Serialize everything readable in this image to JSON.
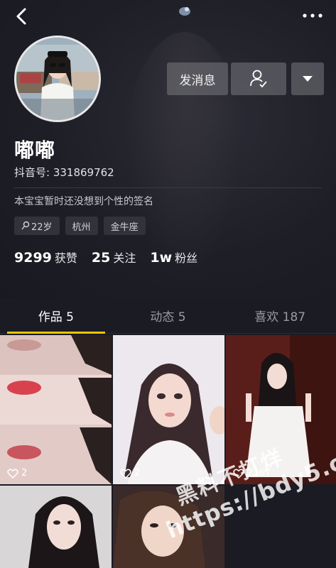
{
  "header": {
    "send_message_label": "发消息"
  },
  "profile": {
    "nickname": "嘟嘟",
    "douyin_id": "抖音号: 331869762",
    "bio": "本宝宝暂时还没想到个性的签名",
    "tags": [
      "22岁",
      "杭州",
      "金牛座"
    ]
  },
  "stats": {
    "likes_count": "9299",
    "likes_label": "获赞",
    "following_count": "25",
    "following_label": "关注",
    "followers_count": "1w",
    "followers_label": "粉丝"
  },
  "tabs": [
    {
      "label": "作品 5"
    },
    {
      "label": "动态 5"
    },
    {
      "label": "喜欢 187"
    }
  ],
  "videos": [
    {
      "likes": "2"
    },
    {
      "likes": "2"
    },
    {
      "likes": "2167"
    }
  ],
  "watermark": {
    "line1": "黑料不打烊",
    "line2": "https://bdy5.co"
  },
  "colors": {
    "accent": "#f5c400",
    "background": "#1b1b24"
  }
}
